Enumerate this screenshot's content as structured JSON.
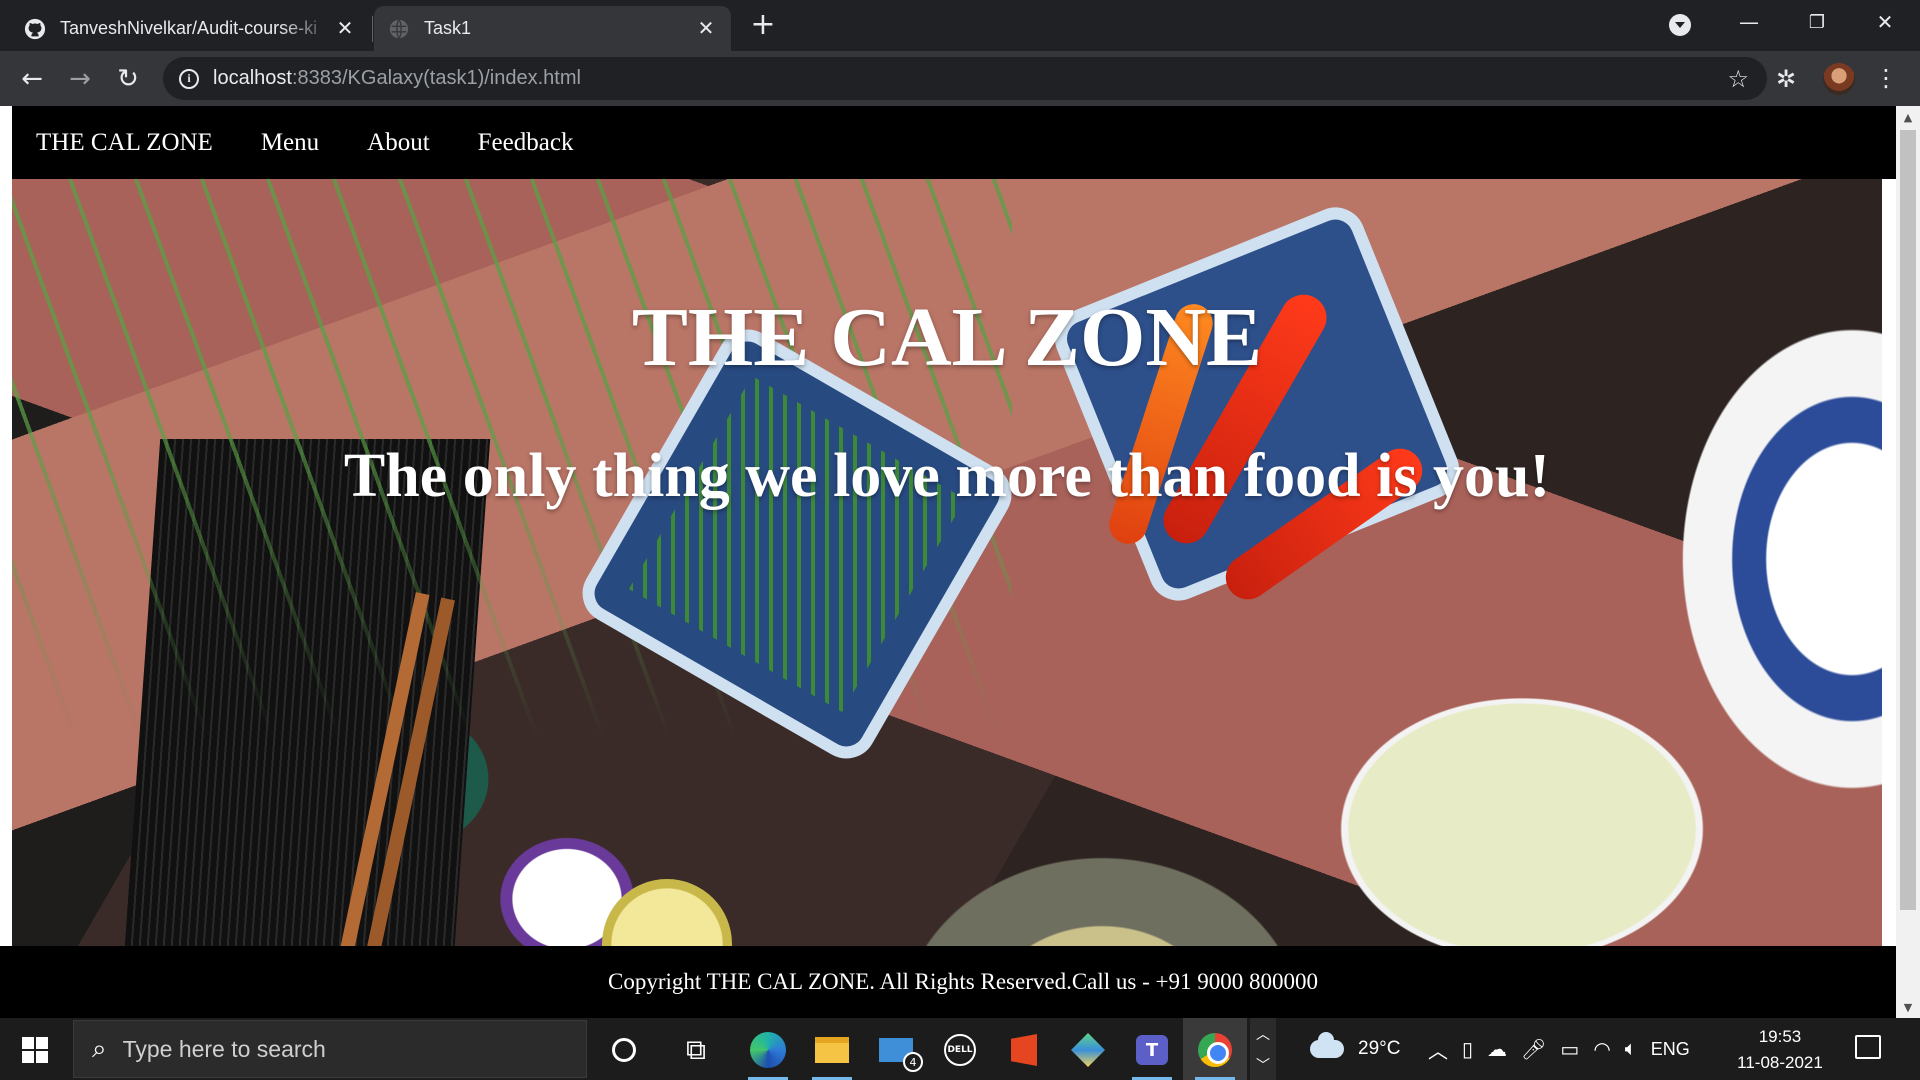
{
  "browser": {
    "tabs": [
      {
        "title": "TanveshNivelkar/Audit-course-ki",
        "favicon": "github-icon",
        "active": false
      },
      {
        "title": "Task1",
        "favicon": "globe-icon",
        "active": true
      }
    ],
    "url_host": "localhost",
    "url_rest": ":8383/KGalaxy(task1)/index.html"
  },
  "site": {
    "nav": {
      "brand": "THE CAL ZONE",
      "links": [
        "Menu",
        "About",
        "Feedback"
      ]
    },
    "hero": {
      "title": "THE CAL ZONE",
      "subtitle": "The only thing we love more than food is you!"
    },
    "footer": "Copyright THE CAL ZONE. All Rights Reserved.Call us - +91 9000 800000"
  },
  "taskbar": {
    "search_placeholder": "Type here to search",
    "mail_badge": "4",
    "dell_label": "DELL",
    "teams_label": "T",
    "weather": "29°C",
    "language": "ENG",
    "time": "19:53",
    "date": "11-08-2021"
  }
}
